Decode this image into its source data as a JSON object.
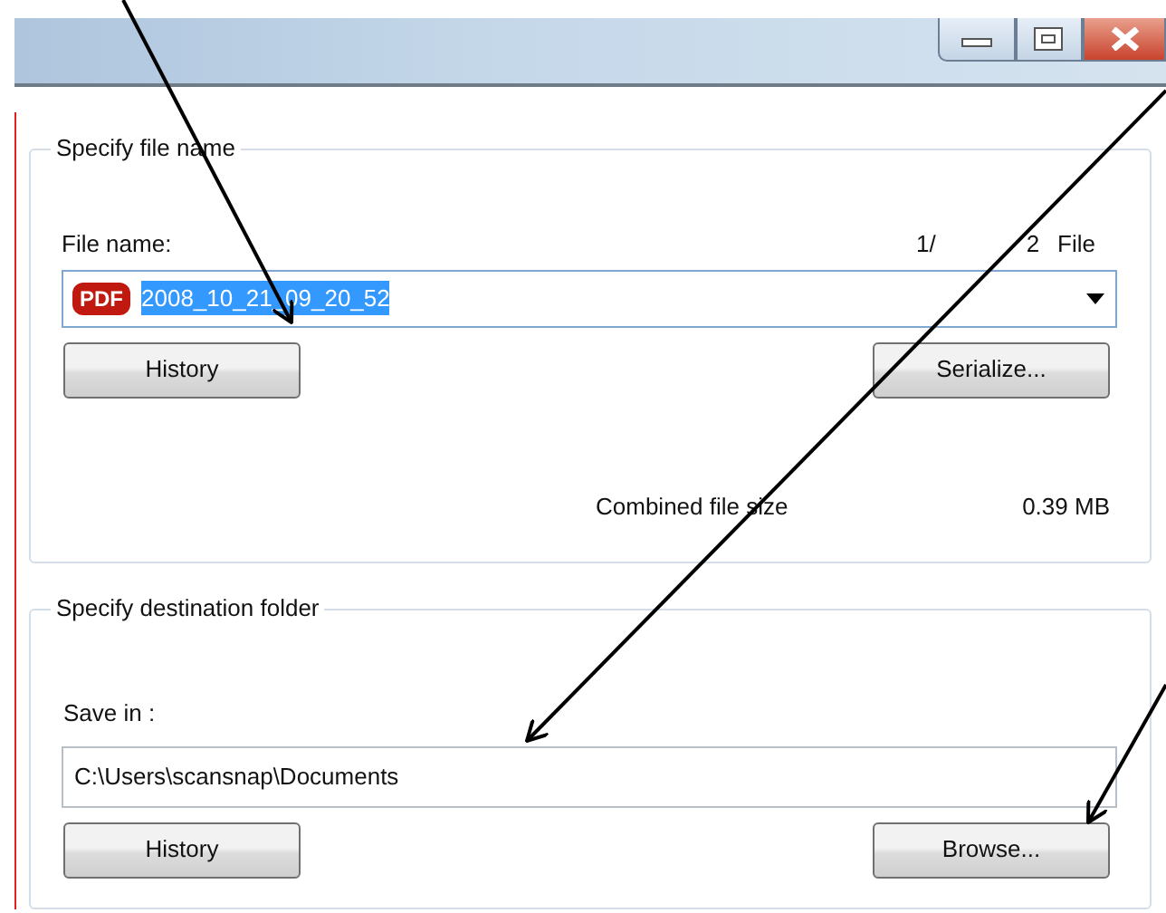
{
  "window": {
    "caption_buttons": [
      {
        "kind": "minimize"
      },
      {
        "kind": "maximize"
      },
      {
        "kind": "close"
      }
    ]
  },
  "file_name_group": {
    "title": "Specify file name",
    "label": "File name:",
    "page_counter": {
      "current": "1/",
      "total": "2",
      "unit": "File"
    },
    "file_type_badge": "PDF",
    "file_name": {
      "value": "2008_10_21_09_20_52",
      "text_selected": true
    },
    "buttons": [
      "History",
      "Serialize..."
    ],
    "combined_size_label": "Combined file size",
    "combined_size": "0.39 MB"
  },
  "destination_group": {
    "title": "Specify destination folder",
    "label": "Save in :",
    "path": "C:\\Users\\scansnap\\Documents",
    "buttons": [
      "History",
      "Browse..."
    ]
  }
}
